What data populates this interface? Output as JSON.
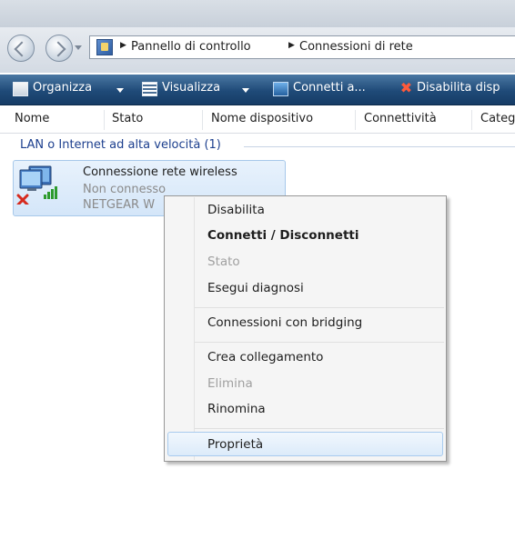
{
  "address": {
    "crumbs": [
      "Pannello di controllo",
      "Connessioni di rete"
    ]
  },
  "toolbar": {
    "organize_label": "Organizza",
    "view_label": "Visualizza",
    "connect_label": "Connetti a...",
    "disable_label": "Disabilita disp"
  },
  "columns": [
    "Nome",
    "Stato",
    "Nome dispositivo",
    "Connettività",
    "Categ"
  ],
  "group": {
    "title": "LAN o Internet ad alta velocità (1)"
  },
  "connection": {
    "name": "Connessione rete wireless",
    "status": "Non connesso",
    "device": "NETGEAR W"
  },
  "context_menu": {
    "items": [
      {
        "label": "Disabilita"
      },
      {
        "label": "Connetti / Disconnetti"
      },
      {
        "label": "Stato"
      },
      {
        "label": "Esegui diagnosi"
      },
      {
        "label": "Connessioni con bridging"
      },
      {
        "label": "Crea collegamento"
      },
      {
        "label": "Elimina"
      },
      {
        "label": "Rinomina"
      },
      {
        "label": "Proprietà"
      }
    ]
  },
  "colors": {
    "command_bar": "#1f4a78",
    "group_header": "#1c3f8e",
    "menu_highlight": "#dcebfa",
    "disconnected_x": "#d62a1e"
  }
}
